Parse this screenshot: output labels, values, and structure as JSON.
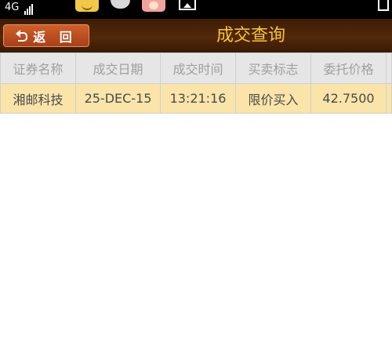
{
  "status_bar": {
    "signal_text": "4G",
    "notification_icons": [
      "smiley-app-icon",
      "cloud-icon",
      "avatar-app-icon",
      "image-icon"
    ],
    "battery_icon": "battery-icon"
  },
  "header": {
    "back_label": "返 回",
    "back_icon": "back-arrow-icon",
    "title": "成交查询"
  },
  "table": {
    "columns": [
      "证券名称",
      "成交日期",
      "成交时间",
      "买卖标志",
      "委托价格"
    ],
    "rows": [
      [
        "湘邮科技",
        "25-DEC-15",
        "13:21:16",
        "限价买入",
        "42.7500"
      ]
    ]
  },
  "colors": {
    "header_bg": "#4a2308",
    "title": "#f5c43a",
    "back_button": "#c0502a",
    "table_header_bg": "#e6e6e6",
    "row_highlight": "#fae4aa"
  }
}
